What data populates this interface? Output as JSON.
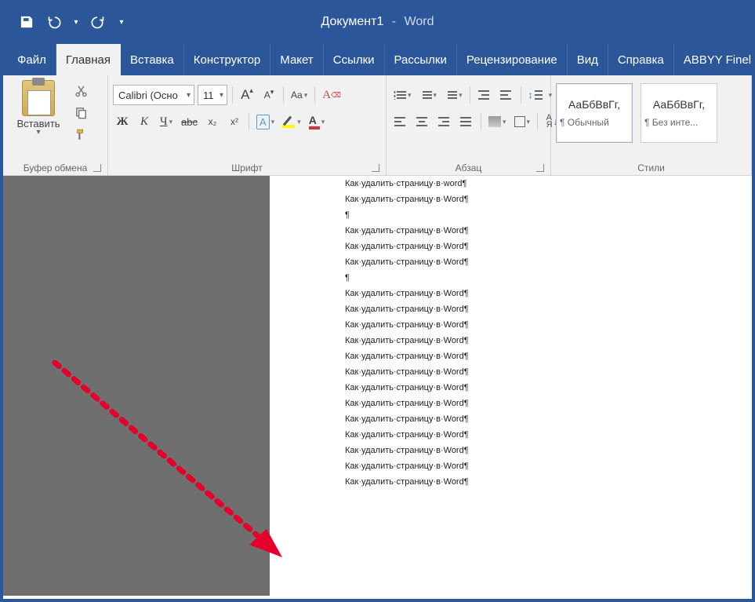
{
  "title": {
    "doc": "Документ1",
    "sep": "-",
    "app": "Word"
  },
  "tabs": [
    "Файл",
    "Главная",
    "Вставка",
    "Конструктор",
    "Макет",
    "Ссылки",
    "Рассылки",
    "Рецензирование",
    "Вид",
    "Справка",
    "ABBYY Finel"
  ],
  "active_tab": 1,
  "clipboard": {
    "paste": "Вставить",
    "group": "Буфер обмена"
  },
  "font": {
    "name": "Calibri (Осно",
    "size": "11",
    "grow": "A",
    "shrink": "A",
    "caseBtn": "Aa",
    "clear": "A",
    "bold": "Ж",
    "italic": "К",
    "underline": "Ч",
    "strike": "abc",
    "sub": "x₂",
    "sup": "x²",
    "effects": "A",
    "highlight": "",
    "color": "A",
    "group": "Шрифт"
  },
  "para": {
    "group": "Абзац",
    "pilcrow": "¶",
    "sortA": "A",
    "sortZ": "Я"
  },
  "styles": {
    "group": "Стили",
    "preview": "АаБбВвГг,",
    "items": [
      {
        "name": "¶ Обычный"
      },
      {
        "name": "¶ Без инте..."
      }
    ]
  },
  "doc_lines": [
    "Как·удалить·страницу·в·word¶",
    "Как·удалить·страницу·в·Word¶",
    "¶",
    "Как·удалить·страницу·в·Word¶",
    "Как·удалить·страницу·в·Word¶",
    "Как·удалить·страницу·в·Word¶",
    "¶",
    "Как·удалить·страницу·в·Word¶",
    "Как·удалить·страницу·в·Word¶",
    "Как·удалить·страницу·в·Word¶",
    "Как·удалить·страницу·в·Word¶",
    "Как·удалить·страницу·в·Word¶",
    "Как·удалить·страницу·в·Word¶",
    "Как·удалить·страницу·в·Word¶",
    "Как·удалить·страницу·в·Word¶",
    "Как·удалить·страницу·в·Word¶",
    "Как·удалить·страницу·в·Word¶",
    "Как·удалить·страницу·в·Word¶",
    "Как·удалить·страницу·в·Word¶",
    "Как·удалить·страницу·в·Word¶"
  ]
}
